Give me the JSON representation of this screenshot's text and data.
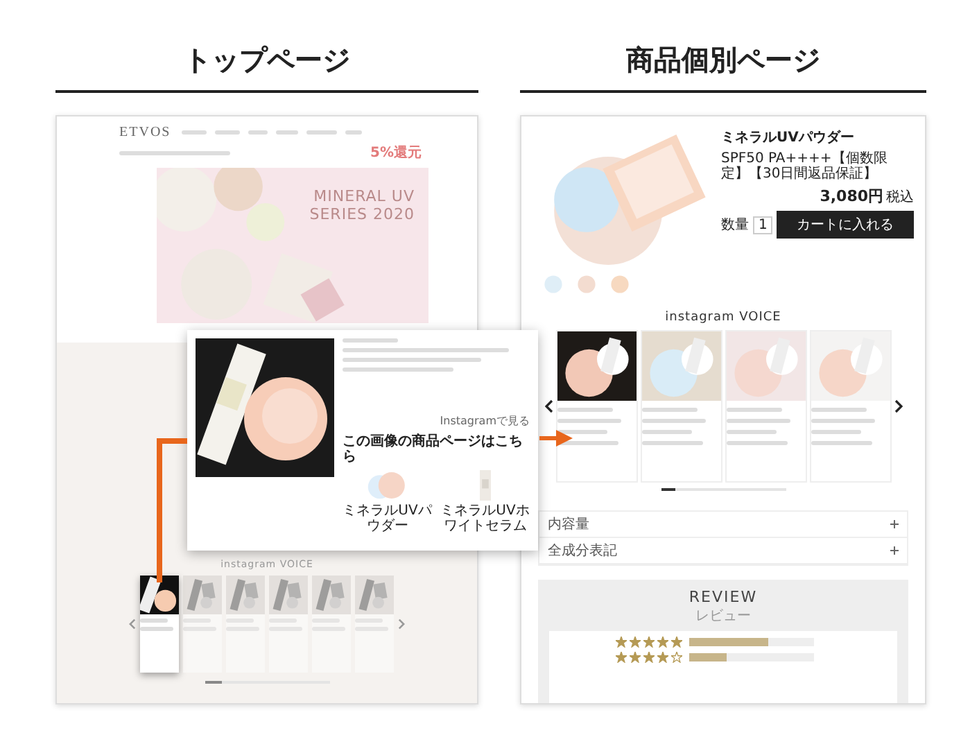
{
  "headings": [
    {
      "text": "トップページ"
    },
    {
      "text": "商品個別ページ"
    }
  ],
  "top_page": {
    "logo": "ETVOS",
    "promo": "5%還元",
    "banner_text": "MINERAL UV SERIES 2020",
    "section_title": "instagram VOICE",
    "cards": [
      {
        "selected": true
      },
      {
        "selected": false
      },
      {
        "selected": false
      },
      {
        "selected": false
      },
      {
        "selected": false
      },
      {
        "selected": false
      }
    ]
  },
  "popup": {
    "link": "Instagramで見る",
    "products_heading": "この画像の商品ページはこちら",
    "products": [
      {
        "name": "ミネラルUVパウダー"
      },
      {
        "name": "ミネラルUVホワイトセラム"
      }
    ]
  },
  "product_page": {
    "title": "ミネラルUVパウダー",
    "subtitle": "SPF50 PA++++【個数限定】【30日間返品保証】",
    "price": "3,080円",
    "tax": "税込",
    "quantity_label": "数量",
    "quantity": "1",
    "cart_button": "カートに入れる",
    "section_title": "instagram VOICE",
    "accordion": [
      {
        "label": "内容量",
        "expanded": false
      },
      {
        "label": "全成分表記",
        "expanded": false
      }
    ],
    "review": {
      "title": "REVIEW",
      "subtitle": "レビュー",
      "rows": [
        {
          "stars": 5,
          "level": 0.63
        },
        {
          "stars": 4,
          "level": 0.3
        }
      ]
    }
  }
}
